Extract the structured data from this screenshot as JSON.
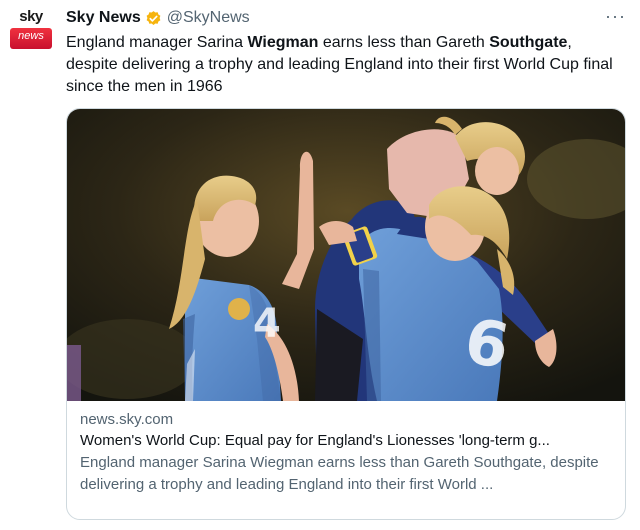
{
  "account": {
    "avatar_top": "sky",
    "avatar_bottom": "news",
    "name": "Sky News",
    "handle": "@SkyNews",
    "verified_icon": "verified-badge-icon",
    "more_icon": "more-options-icon",
    "more_label": "···"
  },
  "tweet": {
    "text_part1": "England manager Sarina ",
    "text_bold1": "Wiegman",
    "text_part2": " earns less than Gareth ",
    "text_bold2": "Southgate",
    "text_part3": ", despite delivering a trophy and leading England into their first World Cup final since the men in 1966"
  },
  "card": {
    "domain": "news.sky.com",
    "title": "Women's World Cup: Equal pay for England's Lionesses 'long-term g...",
    "description": "England manager Sarina Wiegman earns less than Gareth Southgate, despite delivering a trophy and leading England into their first World ..."
  },
  "colors": {
    "accent_gold": "#f6b40e",
    "sky_red": "#d4101f",
    "jersey_blue": "#5d8fcf",
    "navy": "#22367a"
  }
}
